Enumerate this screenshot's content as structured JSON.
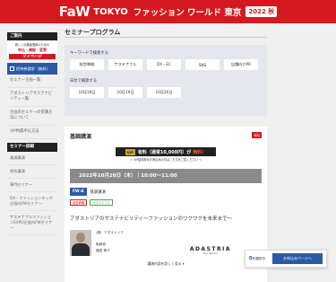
{
  "header": {
    "logo_fw": "FaW",
    "logo_tokyo": "TOKYO",
    "logo_jp": "ファッション ワールド 東京",
    "badge": "2022 秋"
  },
  "sidebar": {
    "guide_head": "ご案内",
    "banner_line1": "新しく出展者登録のための",
    "banner_line2": "申込・確認・変更",
    "banner_line3": "マイページ",
    "free_register": "招待券請求（無料）",
    "items": [
      "セミナー企画一覧",
      "アダストリアサステナビリティ一覧",
      "企画内セミナーの受講方法について",
      "VIP特典申込方法"
    ],
    "seminar_head": "セミナー詳細",
    "items2": [
      "基調講演",
      "特別講演",
      "専門セミナー",
      "DX・ファッションテック企画内FWセミナー",
      "サステナブルファッションEXPO企画内FWセミナー"
    ]
  },
  "main": {
    "title": "セミナープログラム",
    "keyword_label": "キーワードで検索する",
    "keywords": [
      "経営戦略",
      "サステナブル",
      "DX・EC",
      "SNS",
      "店舗向けPR"
    ],
    "date_label": "日付で検索する",
    "dates": [
      "10月18日",
      "10月19日",
      "10月20日"
    ]
  },
  "lecture": {
    "title": "基調講演",
    "tag": "有料",
    "vip_label": "VIP",
    "vip_price": "有料（通常10,000円）が",
    "vip_free": "無料！",
    "vip_sub": "＞ VIP招待券をお申込みの方はこちらをご覧ください ＜",
    "date": "2022年10月20日（木）｜10:00〜11:00",
    "room": "FW-A",
    "room_name": "基調講演",
    "tags": [
      "経営戦略",
      "サステナブル"
    ],
    "talk_title": "アダストリアのサステナビリティ〜ファッションのワクワクを未来まで〜",
    "org": "(株）アダストリア",
    "role": "取締役",
    "name": "福田 泰介",
    "company": "ADASTRIA",
    "company_sub": "Play fashion!",
    "show_more": "講演内容を詳しく見る ▾"
  },
  "cta": {
    "count": "0",
    "select_label": "件選択中",
    "apply": "お申込みページへ"
  }
}
